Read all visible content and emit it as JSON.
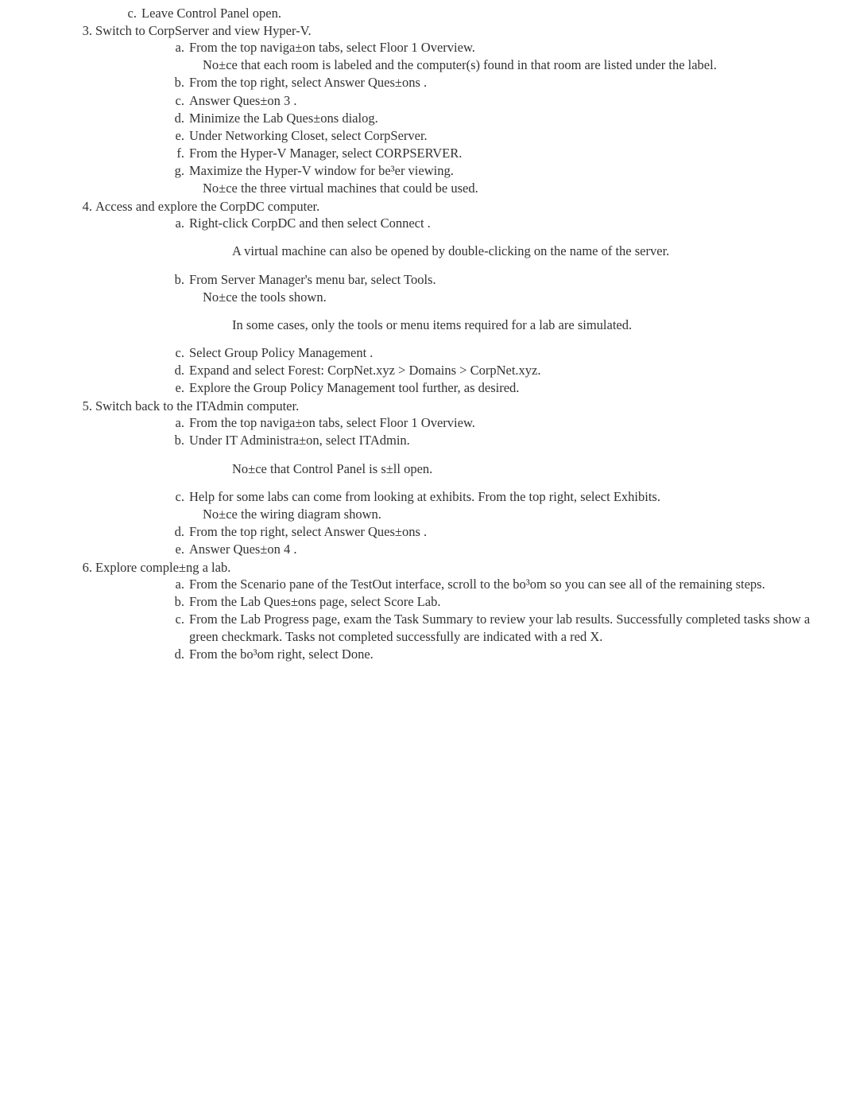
{
  "item2c": {
    "marker": "c.",
    "text": "Leave Control Panel open."
  },
  "item3": {
    "marker": "3.",
    "text": "Switch to CorpServer and view Hyper-V.",
    "a": {
      "marker": "a.",
      "text": "From the top naviga±on tabs, select  Floor 1 Overview.",
      "sub": "No±ce that each room is labeled and the computer(s) found in that room are listed under the label."
    },
    "b": {
      "marker": "b.",
      "text": "From the top right, select  Answer Ques±ons ."
    },
    "c": {
      "marker": "c.",
      "text": "Answer Ques±on 3 ."
    },
    "d": {
      "marker": "d.",
      "text": "Minimize the Lab Ques±ons dialog."
    },
    "e": {
      "marker": "e.",
      "text": "Under Networking Closet, select CorpServer."
    },
    "f": {
      "marker": "f.",
      "text": "From the Hyper-V Manager, select CORPSERVER."
    },
    "g": {
      "marker": "g.",
      "text": "Maximize the Hyper-V window for be³er viewing.",
      "sub": "No±ce the three virtual machines that could be used."
    }
  },
  "item4": {
    "marker": "4.",
    "text": "Access and explore the CorpDC computer.",
    "a": {
      "marker": "a.",
      "text": "Right-click CorpDC and then select  Connect .",
      "note": "A virtual machine can also be opened by double-clicking on the name of the server."
    },
    "b": {
      "marker": "b.",
      "text": "From Server Manager's menu bar, select  Tools.",
      "sub": "No±ce the tools shown.",
      "note": "In some cases, only the tools or menu items required for a lab are simulated."
    },
    "c": {
      "marker": "c.",
      "text": "Select Group Policy Management ."
    },
    "d": {
      "marker": "d.",
      "text": "Expand and select Forest: CorpNet.xyz > Domains > CorpNet.xyz."
    },
    "e": {
      "marker": "e.",
      "text": "Explore the Group Policy Management tool further, as desired."
    }
  },
  "item5": {
    "marker": "5.",
    "text": "Switch back to the ITAdmin computer.",
    "a": {
      "marker": "a.",
      "text": "From the top naviga±on tabs, select  Floor 1 Overview."
    },
    "b": {
      "marker": "b.",
      "text": "Under IT Administra±on, select ITAdmin.",
      "note": "No±ce that Control Panel is s±ll open."
    },
    "c": {
      "marker": "c.",
      "text": "Help for some labs can come from looking at exhibits. From the top right, select  Exhibits.",
      "sub": "No±ce the wiring diagram shown."
    },
    "d": {
      "marker": "d.",
      "text": "From the top right, select  Answer Ques±ons ."
    },
    "e": {
      "marker": "e.",
      "text": "Answer Ques±on 4 ."
    }
  },
  "item6": {
    "marker": "6.",
    "text": "Explore comple±ng a lab.",
    "a": {
      "marker": "a.",
      "text": "From the Scenario pane of the TestOut interface, scroll to the bo³om so you can see all of the remaining steps."
    },
    "b": {
      "marker": "b.",
      "text": "From the Lab Ques±ons page, select Score Lab."
    },
    "c": {
      "marker": "c.",
      "text": "From the Lab Progress page, exam the Task Summary to review your lab results. Successfully completed tasks show a green checkmark. Tasks not completed successfully are indicated with a red X."
    },
    "d": {
      "marker": "d.",
      "text": "From the bo³om right, select  Done."
    }
  }
}
